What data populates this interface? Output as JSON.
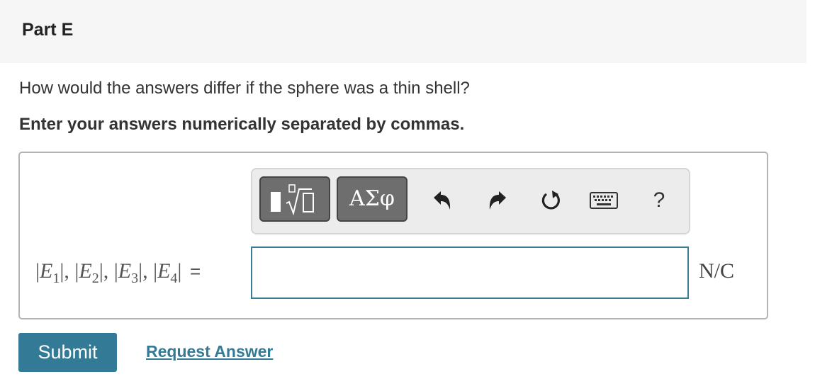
{
  "part": {
    "title": "Part E"
  },
  "question": {
    "text": "How would the answers differ if the sphere was a thin shell?"
  },
  "instruction": {
    "text": "Enter your answers numerically separated by commas."
  },
  "toolbar": {
    "templates_icon": "templates-sqrt-icon",
    "symbols_label": "ΑΣφ",
    "undo_icon": "undo-icon",
    "redo_icon": "redo-icon",
    "reset_icon": "reset-icon",
    "keyboard_icon": "keyboard-icon",
    "help_label": "?"
  },
  "answer": {
    "label_parts": [
      {
        "var": "E",
        "sub": "1"
      },
      {
        "var": "E",
        "sub": "2"
      },
      {
        "var": "E",
        "sub": "3"
      },
      {
        "var": "E",
        "sub": "4"
      }
    ],
    "separator": ", ",
    "equals": "=",
    "value": "",
    "unit": "N/C"
  },
  "actions": {
    "submit_label": "Submit",
    "request_label": "Request Answer"
  },
  "colors": {
    "accent": "#337a97",
    "header_bg": "#f6f6f6",
    "toolbar_button": "#6e6e6e"
  }
}
